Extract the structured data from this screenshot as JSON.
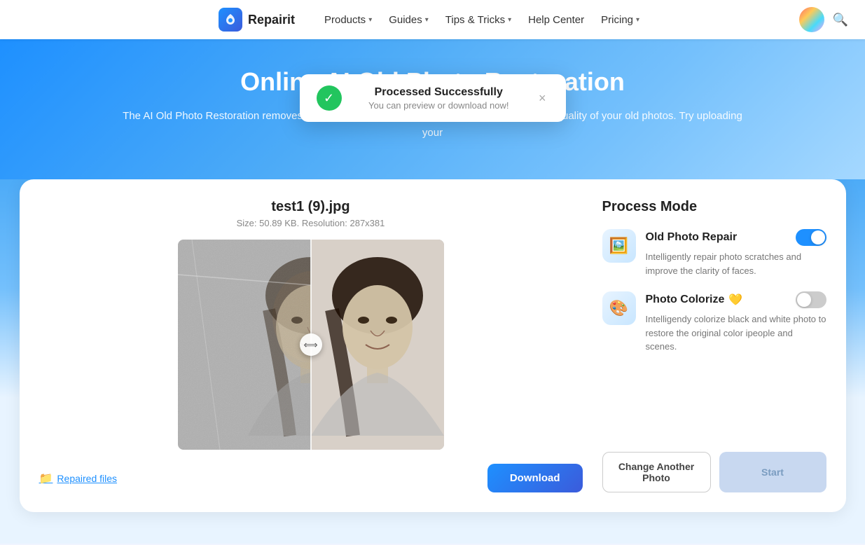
{
  "navbar": {
    "logo_text": "Repairit",
    "items": [
      {
        "label": "Products",
        "has_chevron": true
      },
      {
        "label": "Guides",
        "has_chevron": true
      },
      {
        "label": "Tips & Tricks",
        "has_chevron": true
      },
      {
        "label": "Help Center",
        "has_chevron": false
      },
      {
        "label": "Pricing",
        "has_chevron": true
      }
    ]
  },
  "hero": {
    "title": "Online AI Old Photo Restoration",
    "description": "The AI Old Photo Restoration removes scratches, enhances details, and restores the original quality of your old photos. Try uploading your"
  },
  "notification": {
    "title": "Processed Successfully",
    "subtitle": "You can preview or download now!",
    "close_label": "×"
  },
  "photo_panel": {
    "filename": "test1 (9).jpg",
    "meta": "Size: 50.89 KB. Resolution: 287x381",
    "repaired_files_label": "Repaired files",
    "download_label": "Download"
  },
  "process_mode": {
    "title": "Process Mode",
    "modes": [
      {
        "name": "Old Photo Repair",
        "description": "Intelligently repair photo scratches and improve the clarity of faces.",
        "icon": "🖼️",
        "toggle_state": "on",
        "has_premium": false
      },
      {
        "name": "Photo Colorize",
        "description": "Intelligendy colorize black and white photo to restore the original color ipeople and scenes.",
        "icon": "🎨",
        "toggle_state": "off",
        "has_premium": true
      }
    ],
    "change_photo_label": "Change Another Photo",
    "start_label": "Start"
  }
}
